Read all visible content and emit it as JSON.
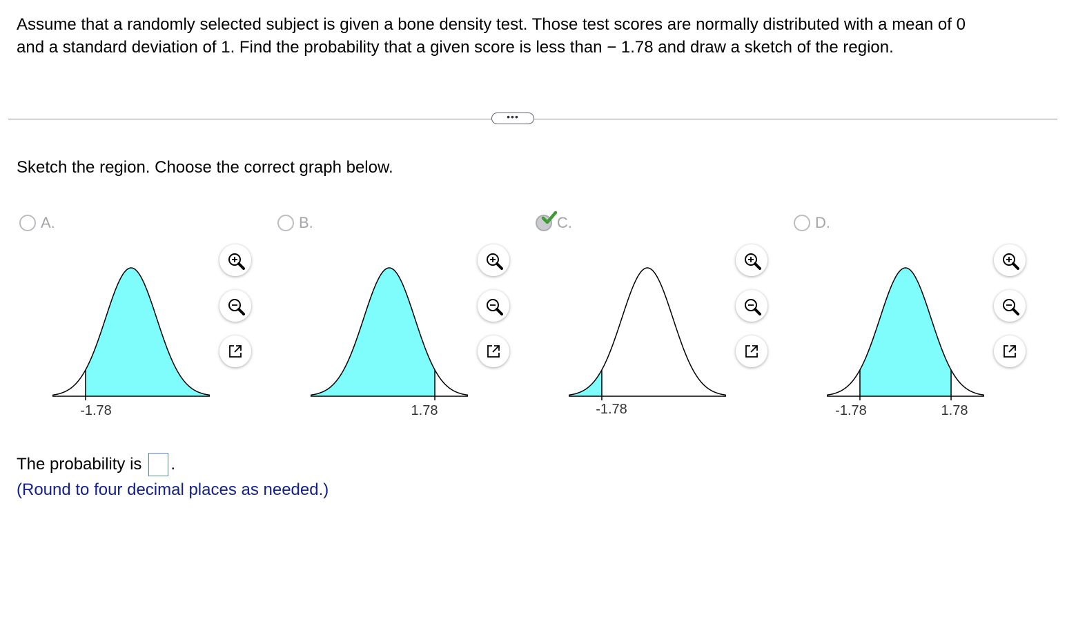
{
  "question": {
    "line1": "Assume that a randomly selected subject is given a bone density test. Those test scores are normally distributed with a mean of 0",
    "line2": "and a standard deviation of 1. Find the probability that a given score is less than − 1.78 and draw a sketch of the region."
  },
  "more_button": "•••",
  "instruction": "Sketch the region. Choose the correct graph below.",
  "options": [
    {
      "letter": "A.",
      "selected": false,
      "shade": "right-of",
      "labels": [
        "-1.78"
      ]
    },
    {
      "letter": "B.",
      "selected": false,
      "shade": "left-of",
      "labels": [
        "1.78"
      ]
    },
    {
      "letter": "C.",
      "selected": true,
      "shade": "left-tail",
      "labels": [
        "-1.78"
      ]
    },
    {
      "letter": "D.",
      "selected": false,
      "shade": "between",
      "labels": [
        "-1.78",
        "1.78"
      ]
    }
  ],
  "tools": {
    "zoom_in": "zoom-in-icon",
    "zoom_out": "zoom-out-icon",
    "expand": "expand-icon"
  },
  "answer": {
    "prefix": "The probability is",
    "value": "",
    "suffix": "."
  },
  "hint": "(Round to four decimal places as needed.)",
  "colors": {
    "fill": "#7ffcfc",
    "check": "#3f9b35",
    "hint": "#14208e",
    "input_border": "#4e7fd6"
  }
}
